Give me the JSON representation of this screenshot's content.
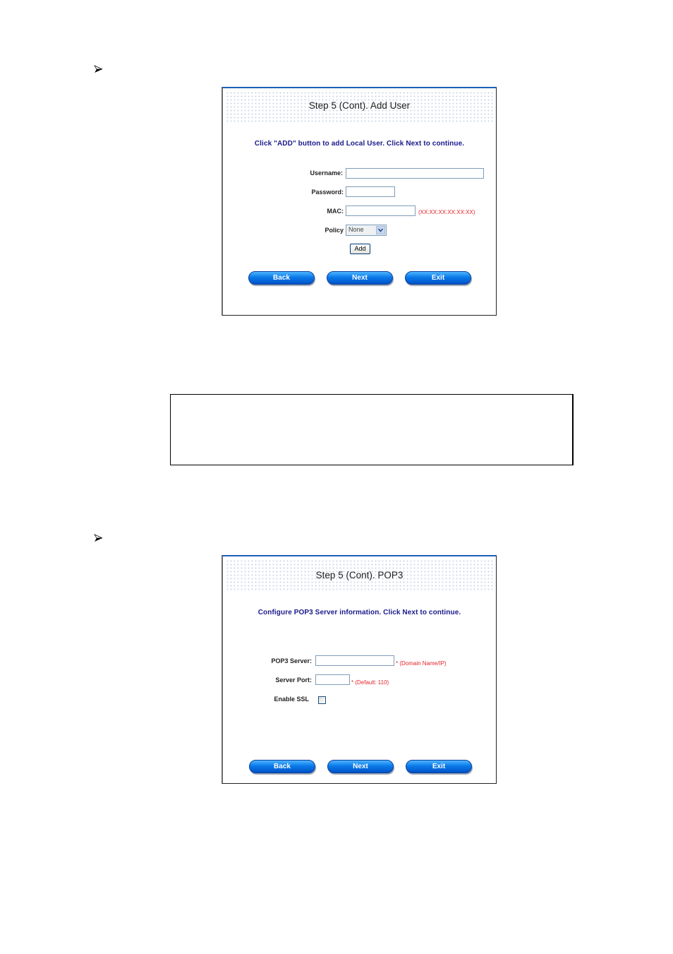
{
  "section1": {
    "bullet_icon": "arrowhead-bullet",
    "panel": {
      "title": "Step 5 (Cont). Add User",
      "instruction": "Click \"ADD\" button to add Local User. Click Next to continue.",
      "fields": {
        "username_label": "Username:",
        "username_value": "",
        "password_label": "Password:",
        "password_value": "",
        "mac_label": "MAC:",
        "mac_value": "",
        "mac_hint": "(XX:XX:XX:XX:XX:XX)",
        "policy_label": "Policy",
        "policy_value": "None"
      },
      "add_button": "Add",
      "buttons": {
        "back": "Back",
        "next": "Next",
        "exit": "Exit"
      }
    }
  },
  "note_box": {
    "text": ""
  },
  "section2": {
    "bullet_icon": "arrowhead-bullet",
    "panel": {
      "title": "Step 5 (Cont). POP3",
      "instruction": "Configure POP3 Server information. Click Next to continue.",
      "fields": {
        "server_label": "POP3 Server:",
        "server_value": "",
        "server_hint": "* (Domain Name/IP)",
        "port_label": "Server Port:",
        "port_value": "",
        "port_hint": "* (Default: 110)",
        "ssl_label": "Enable SSL",
        "ssl_checked": false
      },
      "buttons": {
        "back": "Back",
        "next": "Next",
        "exit": "Exit"
      }
    }
  },
  "colors": {
    "instruction": "#1a1a8c",
    "hint": "#e0242b",
    "button_blue": "#0a7ae8",
    "panel_top_border": "#1c5fb8"
  }
}
